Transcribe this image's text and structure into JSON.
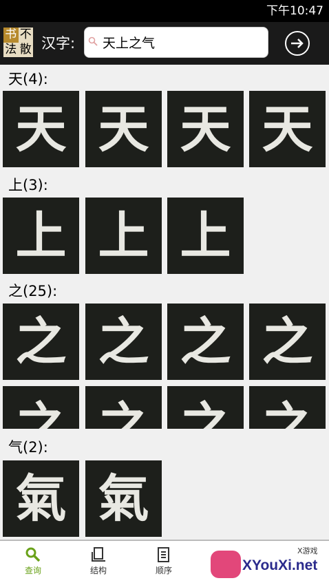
{
  "status_bar": {
    "time": "下午10:47"
  },
  "logo": {
    "chars": [
      "书",
      "不",
      "法",
      "散"
    ]
  },
  "header": {
    "label": "汉字:",
    "query": "天上之气",
    "colors": {
      "bar": "#1a1a1a",
      "logo_gold": "#b78a2d"
    }
  },
  "sections": [
    {
      "heading": "天(4):",
      "char": "天",
      "count": 4
    },
    {
      "heading": "上(3):",
      "char": "上",
      "count": 3
    },
    {
      "heading": "之(25):",
      "char": "之",
      "count": 25
    },
    {
      "heading": "气(2):",
      "char": "气",
      "count": 2
    }
  ],
  "tile_glyphs": {
    "tian": "天",
    "shang": "上",
    "zhi": "之",
    "qi": "氣"
  },
  "bottom_nav": [
    {
      "label": "查询",
      "icon": "search-icon",
      "active": true
    },
    {
      "label": "结构",
      "icon": "structure-icon",
      "active": false
    },
    {
      "label": "顺序",
      "icon": "order-icon",
      "active": false
    }
  ],
  "watermark": {
    "text": "XYouXi.net",
    "small": "X游戏"
  },
  "colors": {
    "active_nav": "#6aa21a",
    "tile_bg": "#1d1f1b",
    "page_bg": "#f0f0f0"
  }
}
